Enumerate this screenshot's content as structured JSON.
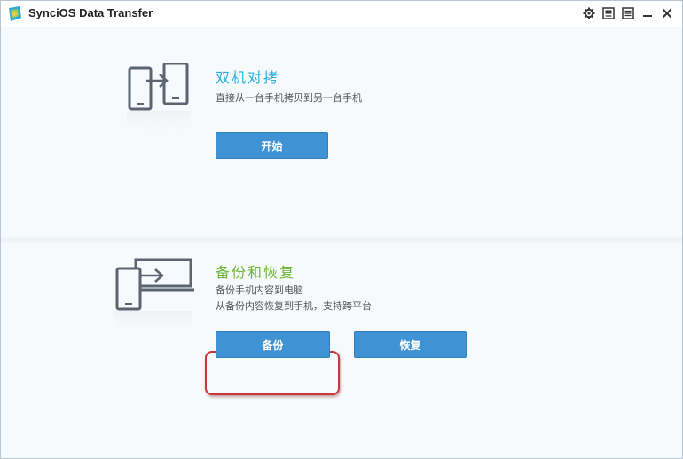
{
  "window": {
    "title": "SynciOS Data Transfer",
    "controls": [
      {
        "name": "settings-icon"
      },
      {
        "name": "skin-icon"
      },
      {
        "name": "menu-icon"
      },
      {
        "name": "minimize-icon"
      },
      {
        "name": "close-icon"
      }
    ]
  },
  "transfer": {
    "title": "双机对拷",
    "description": "直接从一台手机拷贝到另一台手机",
    "start_label": "开始",
    "icon": "phone-to-phone-icon"
  },
  "backup": {
    "title": "备份和恢复",
    "description_1": "备份手机内容到电脑",
    "description_2": "从备份内容恢复到手机，支持跨平台",
    "backup_label": "备份",
    "restore_label": "恢复",
    "icon": "device-to-pc-icon"
  },
  "colors": {
    "accent_blue": "#3f93d4",
    "title_blue": "#27aee0",
    "title_green": "#6bb634",
    "highlight_red": "#c8383a"
  }
}
